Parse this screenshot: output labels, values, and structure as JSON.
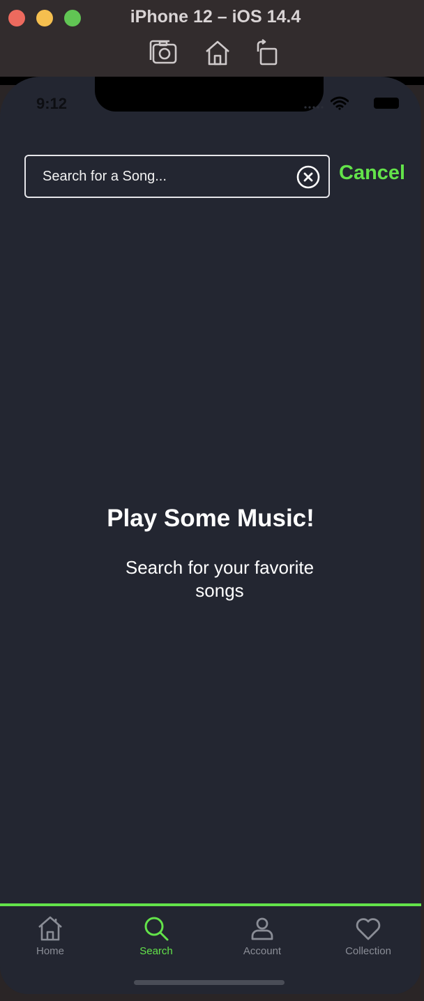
{
  "window": {
    "title": "iPhone 12 – iOS 14.4",
    "toolbar": [
      "screenshot-icon",
      "home-icon",
      "rotate-icon"
    ]
  },
  "status_bar": {
    "time": "9:12"
  },
  "search": {
    "placeholder": "Search for a Song...",
    "value": "",
    "cancel_label": "Cancel"
  },
  "empty_state": {
    "title": "Play Some Music!",
    "subtitle": "Search for your favorite songs"
  },
  "tabbar": {
    "items": [
      {
        "label": "Home",
        "icon": "home-icon",
        "active": false
      },
      {
        "label": "Search",
        "icon": "search-icon",
        "active": true
      },
      {
        "label": "Account",
        "icon": "account-icon",
        "active": false
      },
      {
        "label": "Collection",
        "icon": "heart-icon",
        "active": false
      }
    ]
  },
  "colors": {
    "accent": "#63e34a",
    "background": "#232631",
    "inactive": "#8a8d96"
  }
}
